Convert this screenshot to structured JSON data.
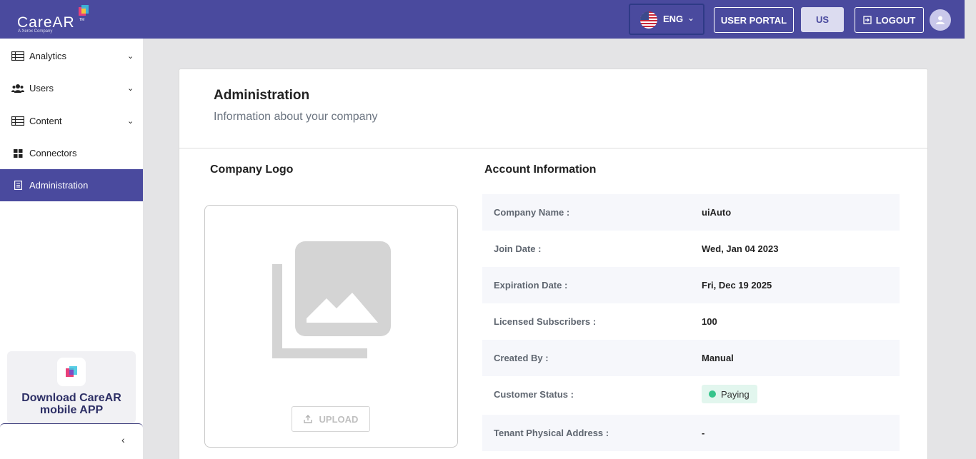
{
  "header": {
    "logo_text": "CareAR",
    "logo_tm": "TM",
    "logo_sub": "A Xerox Company",
    "language": "ENG",
    "user_portal": "USER PORTAL",
    "region": "US",
    "logout": "LOGOUT",
    "brand_color": "#4a4a9e"
  },
  "sidebar": {
    "items": [
      {
        "label": "Analytics",
        "icon": "table-icon",
        "expandable": true
      },
      {
        "label": "Users",
        "icon": "users-icon",
        "expandable": true
      },
      {
        "label": "Content",
        "icon": "table-icon",
        "expandable": true
      },
      {
        "label": "Connectors",
        "icon": "grid-icon",
        "expandable": false
      },
      {
        "label": "Administration",
        "icon": "document-icon",
        "expandable": false,
        "active": true
      }
    ],
    "promo": "Download CareAR mobile APP"
  },
  "main": {
    "title": "Administration",
    "subtitle": "Information about your company",
    "logo_section_title": "Company Logo",
    "upload_label": "UPLOAD",
    "account_section_title": "Account Information",
    "account_rows": [
      {
        "label": "Company Name :",
        "value": "uiAuto"
      },
      {
        "label": "Join Date :",
        "value": "Wed, Jan 04 2023"
      },
      {
        "label": "Expiration Date :",
        "value": "Fri, Dec 19 2025"
      },
      {
        "label": "Licensed Subscribers :",
        "value": "100"
      },
      {
        "label": "Created By :",
        "value": "Manual"
      },
      {
        "label": "Customer Status :",
        "value": "Paying"
      },
      {
        "label": "Tenant Physical Address :",
        "value": "-"
      }
    ]
  }
}
